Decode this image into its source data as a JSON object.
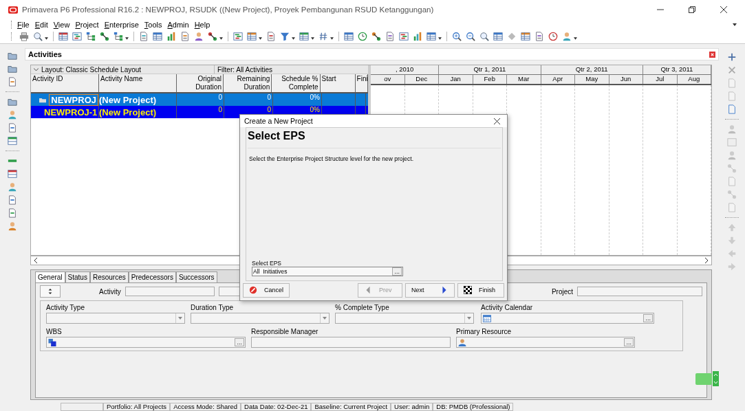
{
  "window": {
    "title": "Primavera P6 Professional R16.2 : NEWPROJ, RSUDK ((New Project), Proyek Pembangunan RSUD Ketanggungan)"
  },
  "menu": [
    {
      "label": "File"
    },
    {
      "label": "Edit"
    },
    {
      "label": "View"
    },
    {
      "label": "Project"
    },
    {
      "label": "Enterprise"
    },
    {
      "label": "Tools"
    },
    {
      "label": "Admin"
    },
    {
      "label": "Help"
    }
  ],
  "activities": {
    "title": "Activities",
    "layout": "Layout: Classic Schedule Layout",
    "filter": "Filter: All Activities",
    "columns": [
      {
        "label": "Activity ID"
      },
      {
        "label": "Activity Name"
      },
      {
        "label": "Original Duration"
      },
      {
        "label": "Remaining Duration"
      },
      {
        "label": "Schedule % Complete"
      },
      {
        "label": "Start"
      },
      {
        "label": "Fini"
      }
    ],
    "rows": [
      {
        "id": "NEWPROJ",
        "name": "(New Project)",
        "original_duration": "0",
        "remaining_duration": "0",
        "schedule_complete": "0%",
        "selected": true
      },
      {
        "id": "NEWPROJ-1",
        "name": "(New Project)",
        "original_duration": "0",
        "remaining_duration": "0",
        "schedule_complete": "0%",
        "selected": false
      }
    ],
    "timescale": [
      {
        "label": ", 2010",
        "months": [
          "ov",
          "Dec"
        ]
      },
      {
        "label": "Qtr 1, 2011",
        "months": [
          "Jan",
          "Feb",
          "Mar"
        ]
      },
      {
        "label": "Qtr 2, 2011",
        "months": [
          "Apr",
          "May",
          "Jun"
        ]
      },
      {
        "label": "Qtr 3, 2011",
        "months": [
          "Jul",
          "Aug"
        ]
      }
    ]
  },
  "details": {
    "tabs": [
      {
        "label": "General",
        "selected": true
      },
      {
        "label": "Status",
        "selected": false
      },
      {
        "label": "Resources",
        "selected": false
      },
      {
        "label": "Predecessors",
        "selected": false
      },
      {
        "label": "Successors",
        "selected": false
      }
    ],
    "activity_label": "Activity",
    "project_label": "Project",
    "fields_row1": [
      {
        "label": "Activity Type",
        "kind": "dropdown"
      },
      {
        "label": "Duration Type",
        "kind": "dropdown"
      },
      {
        "label": "% Complete Type",
        "kind": "dropdown"
      },
      {
        "label": "Activity Calendar",
        "kind": "browse",
        "button": "..."
      }
    ],
    "fields_row2": [
      {
        "label": "WBS",
        "kind": "browse",
        "button": "..."
      },
      {
        "label": "Responsible Manager",
        "kind": "plain"
      },
      {
        "label": "Primary Resource",
        "kind": "browse",
        "button": "..."
      }
    ]
  },
  "dialog": {
    "title": "Create a New Project",
    "heading": "Select EPS",
    "description": "Select the Enterprise Project Structure level for the new project.",
    "eps_label": "Select EPS",
    "eps_value": "All  Initiatives",
    "eps_button": "...",
    "buttons": [
      {
        "label": "Cancel",
        "kind": "cancel",
        "disabled": false
      },
      {
        "label": "Prev",
        "kind": "prev",
        "disabled": true
      },
      {
        "label": "Next",
        "kind": "next",
        "disabled": false
      },
      {
        "label": "Finish",
        "kind": "finish",
        "disabled": false
      }
    ]
  },
  "status_bar": [
    "Portfolio: All Projects",
    "Access Mode: Shared",
    "Data Date: 02-Dec-21",
    "Baseline: Current Project",
    "User: admin",
    "DB: PMDB (Professional)"
  ]
}
